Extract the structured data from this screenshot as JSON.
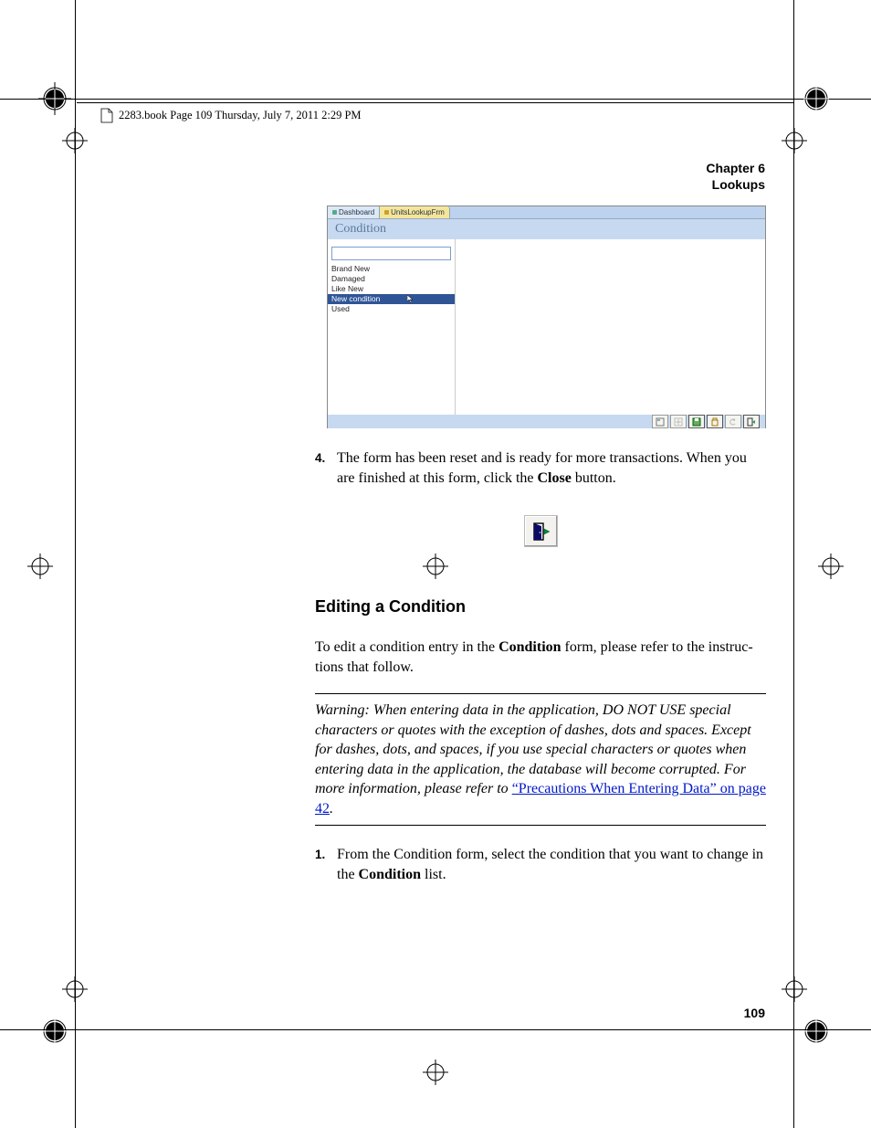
{
  "header": {
    "running": "2283.book  Page 109  Thursday, July 7, 2011  2:29 PM",
    "chapter_line1": "Chapter 6",
    "chapter_line2": "Lookups"
  },
  "screenshot": {
    "tabs": {
      "dashboard": "Dashboard",
      "form": "UnitsLookupFrm"
    },
    "title": "Condition",
    "list": {
      "items": [
        "Brand New",
        "Damaged",
        "Like New",
        "New condition",
        "Used"
      ],
      "selected_index": 3
    },
    "toolbar_icons": [
      "edit-icon",
      "new-icon",
      "save-icon",
      "delete-icon",
      "undo-icon",
      "close-icon"
    ]
  },
  "step4": {
    "num": "4.",
    "text_a": "The form has been reset and is ready for more transactions. When you are finished at this form, click the ",
    "close": "Close",
    "text_b": " button."
  },
  "heading_editing": "Editing a Condition",
  "para_edit": {
    "a": "To edit a condition entry in the ",
    "b": "Condition",
    "c": " form, please refer to the instruc­tions that follow."
  },
  "warning": {
    "lead": "Warning:   ",
    "body": "When entering data in the application, DO NOT USE special characters or quotes with the exception of dashes, dots and spaces. Except for dashes, dots, and spaces, if you use special characters or quotes when entering data in the application, the database will become corrupted. For more information, please refer to ",
    "link": "“Precautions When Entering Data” on page 42",
    "period": "."
  },
  "step1": {
    "num": "1.",
    "a": "From the Condition form, select the condition that you want to change in the ",
    "b": "Condition",
    "c": " list."
  },
  "page_number": "109"
}
